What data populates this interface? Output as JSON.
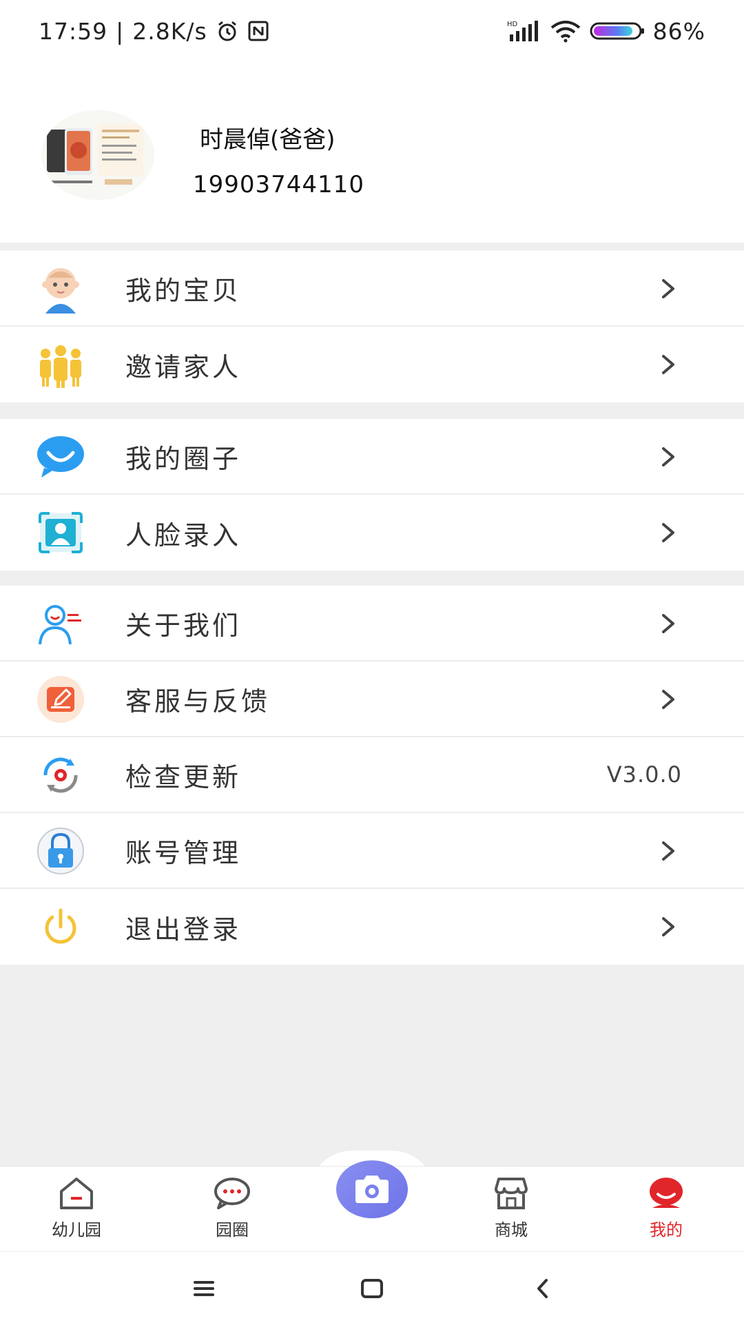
{
  "status_bar": {
    "time": "17:59",
    "speed": "2.8K/s",
    "network_badge": "HD",
    "battery": "86%"
  },
  "profile": {
    "name": "时晨倬(爸爸)",
    "phone": "19903744110"
  },
  "menu": {
    "group1": [
      {
        "label": "我的宝贝",
        "icon": "baby-icon"
      },
      {
        "label": "邀请家人",
        "icon": "family-icon"
      }
    ],
    "group2": [
      {
        "label": "我的圈子",
        "icon": "chat-smile-icon"
      },
      {
        "label": "人脸录入",
        "icon": "face-scan-icon"
      }
    ],
    "group3": [
      {
        "label": "关于我们",
        "icon": "about-us-icon"
      },
      {
        "label": "客服与反馈",
        "icon": "feedback-icon"
      },
      {
        "label": "检查更新",
        "icon": "update-icon",
        "value": "V3.0.0"
      },
      {
        "label": "账号管理",
        "icon": "lock-icon"
      },
      {
        "label": "退出登录",
        "icon": "power-icon"
      }
    ]
  },
  "bottom_nav": [
    {
      "label": "幼儿园",
      "icon": "home-icon"
    },
    {
      "label": "园圈",
      "icon": "chat-bubble-icon"
    },
    {
      "label": "",
      "icon": "camera-icon"
    },
    {
      "label": "商城",
      "icon": "store-icon"
    },
    {
      "label": "我的",
      "icon": "profile-icon",
      "active": true
    }
  ],
  "colors": {
    "accent": "#e0262a",
    "camera": "#7b81ec",
    "background": "#efefef"
  }
}
